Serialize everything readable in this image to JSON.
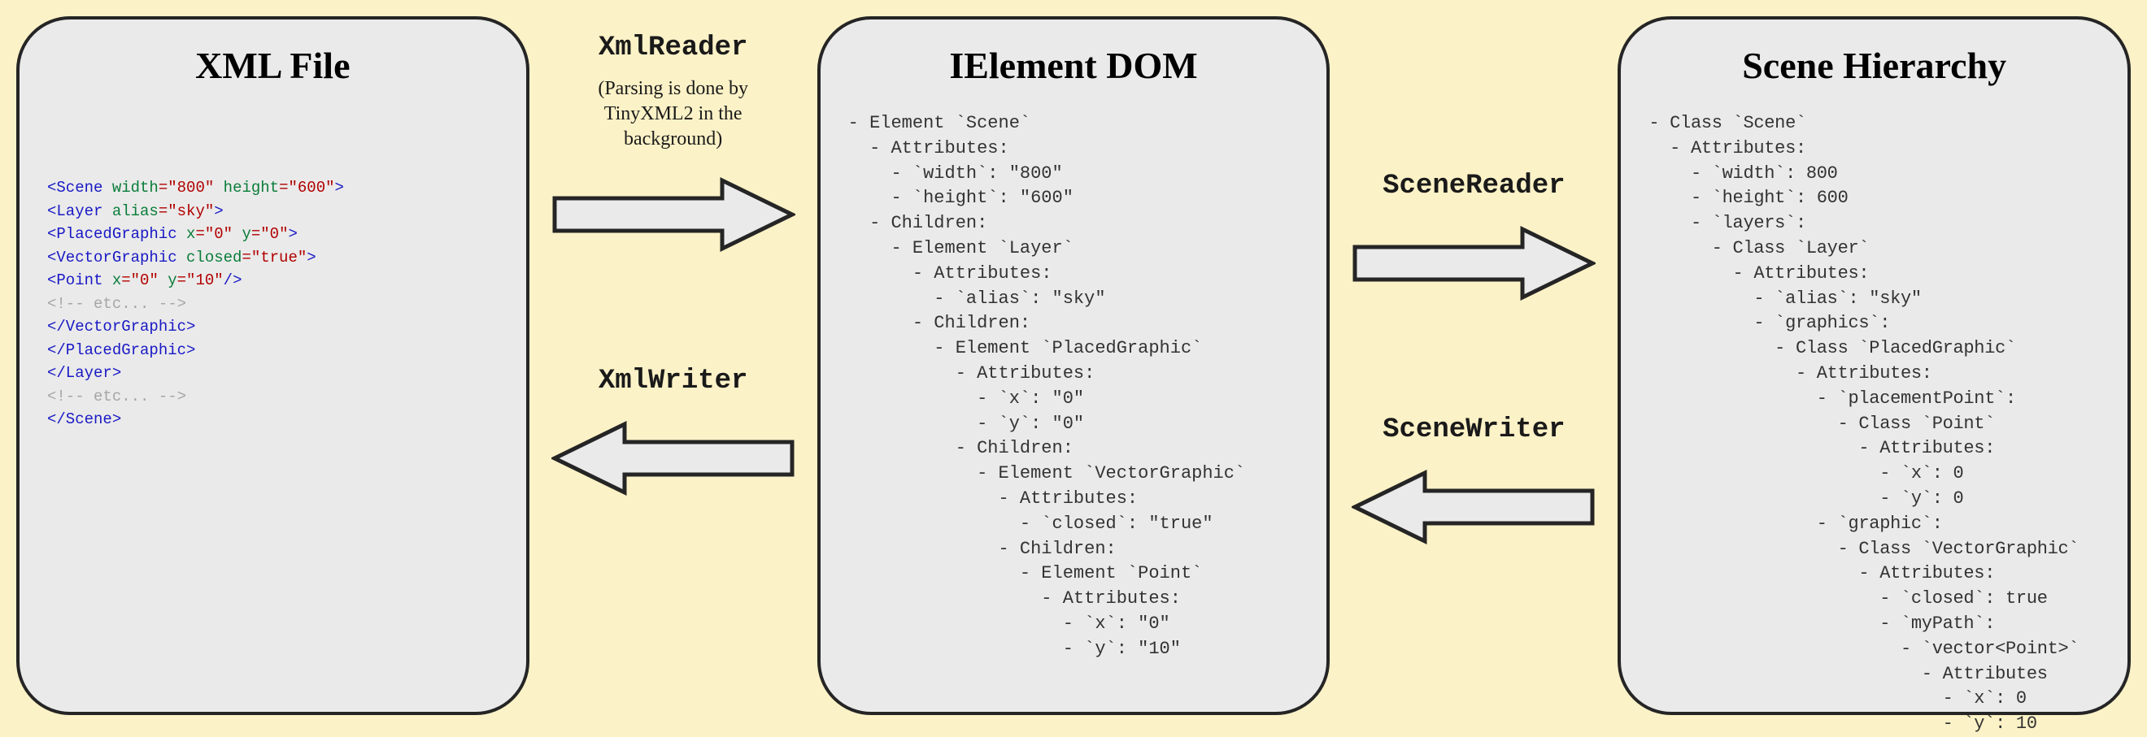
{
  "panels": {
    "xml": {
      "title": "XML File"
    },
    "dom": {
      "title": "IElement DOM"
    },
    "scene": {
      "title": "Scene Hierarchy"
    }
  },
  "connectors": {
    "c1": {
      "top": "XmlReader",
      "note": "(Parsing is done by TinyXML2 in the background)",
      "bottom": "XmlWriter"
    },
    "c2": {
      "top": "SceneReader",
      "bottom": "SceneWriter"
    }
  },
  "xml_code": {
    "l1": {
      "open": "<Scene ",
      "a1": "width",
      "v1": "=\"800\" ",
      "a2": "height",
      "v2": "=\"600\"",
      "close": ">"
    },
    "l2": {
      "pad": "  ",
      "open": "<Layer ",
      "a1": "alias",
      "v1": "=\"sky\"",
      "close": ">"
    },
    "l3": {
      "pad": "    ",
      "open": "<PlacedGraphic ",
      "a1": "x",
      "v1": "=\"0\" ",
      "a2": "y",
      "v2": "=\"0\"",
      "close": ">"
    },
    "l4": {
      "pad": "      ",
      "open": "<VectorGraphic ",
      "a1": "closed",
      "v1": "=\"true\"",
      "close": ">"
    },
    "l5": {
      "pad": "        ",
      "open": "<Point ",
      "a1": "x",
      "v1": "=\"0\" ",
      "a2": "y",
      "v2": "=\"10\"",
      "close": "/>"
    },
    "l6": {
      "pad": "        ",
      "txt": "<!-- etc... -->"
    },
    "l7": {
      "pad": "      ",
      "txt": "</VectorGraphic>"
    },
    "l8": {
      "pad": "    ",
      "txt": "</PlacedGraphic>"
    },
    "l9": {
      "pad": "  ",
      "txt": "</Layer>"
    },
    "l10": {
      "pad": "  ",
      "txt": "<!-- etc... -->"
    },
    "l11": {
      "txt": "</Scene>"
    }
  },
  "dom_text": "- Element `Scene`\n  - Attributes:\n    - `width`: \"800\"\n    - `height`: \"600\"\n  - Children:\n    - Element `Layer`\n      - Attributes:\n        - `alias`: \"sky\"\n      - Children:\n        - Element `PlacedGraphic`\n          - Attributes:\n            - `x`: \"0\"\n            - `y`: \"0\"\n          - Children:\n            - Element `VectorGraphic`\n              - Attributes:\n                - `closed`: \"true\"\n              - Children:\n                - Element `Point`\n                  - Attributes:\n                    - `x`: \"0\"\n                    - `y`: \"10\"",
  "scene_text": "- Class `Scene`\n  - Attributes:\n    - `width`: 800\n    - `height`: 600\n    - `layers`:\n      - Class `Layer`\n        - Attributes:\n          - `alias`: \"sky\"\n          - `graphics`:\n            - Class `PlacedGraphic`\n              - Attributes:\n                - `placementPoint`:\n                  - Class `Point`\n                    - Attributes:\n                      - `x`: 0\n                      - `y`: 0\n                - `graphic`:\n                  - Class `VectorGraphic`\n                    - Attributes:\n                      - `closed`: true\n                      - `myPath`:\n                        - `vector<Point>`\n                          - Attributes\n                            - `x`: 0\n                            - `y`: 10"
}
